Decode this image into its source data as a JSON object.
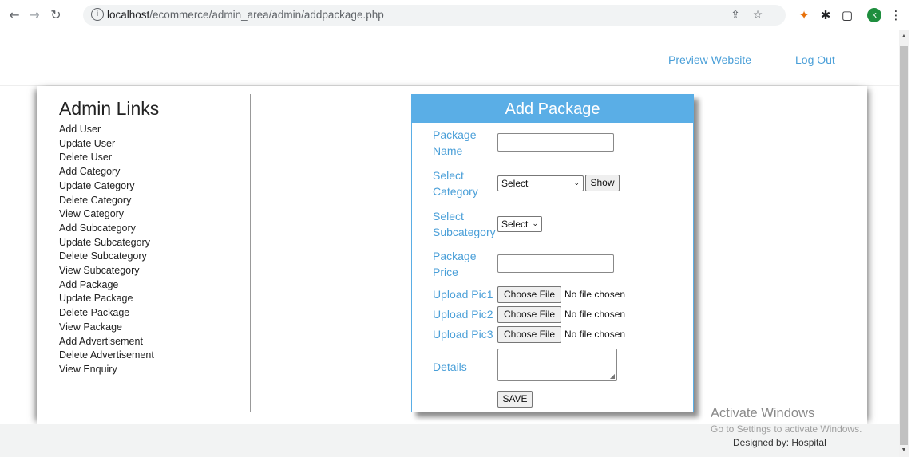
{
  "browser": {
    "url_host": "localhost",
    "url_path": "/ecommerce/admin_area/admin/addpackage.php",
    "avatar_letter": "k",
    "icons": [
      "back-icon",
      "forward-icon",
      "reload-icon",
      "info-icon",
      "share-icon",
      "star-icon",
      "extension-icon",
      "puzzle-icon",
      "sidepanel-icon",
      "menu-icon"
    ]
  },
  "header": {
    "preview_link": "Preview Website",
    "logout_link": "Log Out"
  },
  "sidebar": {
    "title": "Admin Links",
    "links": [
      "Add User",
      "Update User",
      "Delete User",
      "Add Category",
      "Update Category",
      "Delete Category",
      "View Category",
      "Add Subcategory",
      "Update Subcategory",
      "Delete Subcategory",
      "View Subcategory",
      "Add Package",
      "Update Package",
      "Delete Package",
      "View Package",
      "Add Advertisement",
      "Delete Advertisement",
      "View Enquiry"
    ]
  },
  "form": {
    "title": "Add Package",
    "package_name_label_1": "Package",
    "package_name_label_2": "Name",
    "category_label_1": "Select",
    "category_label_2": "Category",
    "category_selected": "Select",
    "show_button": "Show",
    "subcategory_label_1": "Select",
    "subcategory_label_2": "Subcategory",
    "subcategory_selected": "Select",
    "price_label_1": "Package",
    "price_label_2": "Price",
    "pic1_label": "Upload Pic1",
    "pic2_label": "Upload Pic2",
    "pic3_label": "Upload Pic3",
    "choose_file": "Choose File",
    "no_file": "No file chosen",
    "details_label": "Details",
    "save_button": "SAVE"
  },
  "footer": {
    "designed_by": "Designed by: Hospital"
  },
  "watermark": {
    "title": "Activate Windows",
    "subtitle": "Go to Settings to activate Windows."
  },
  "colors": {
    "accent": "#5aaee6",
    "link": "#4a9fd8"
  }
}
